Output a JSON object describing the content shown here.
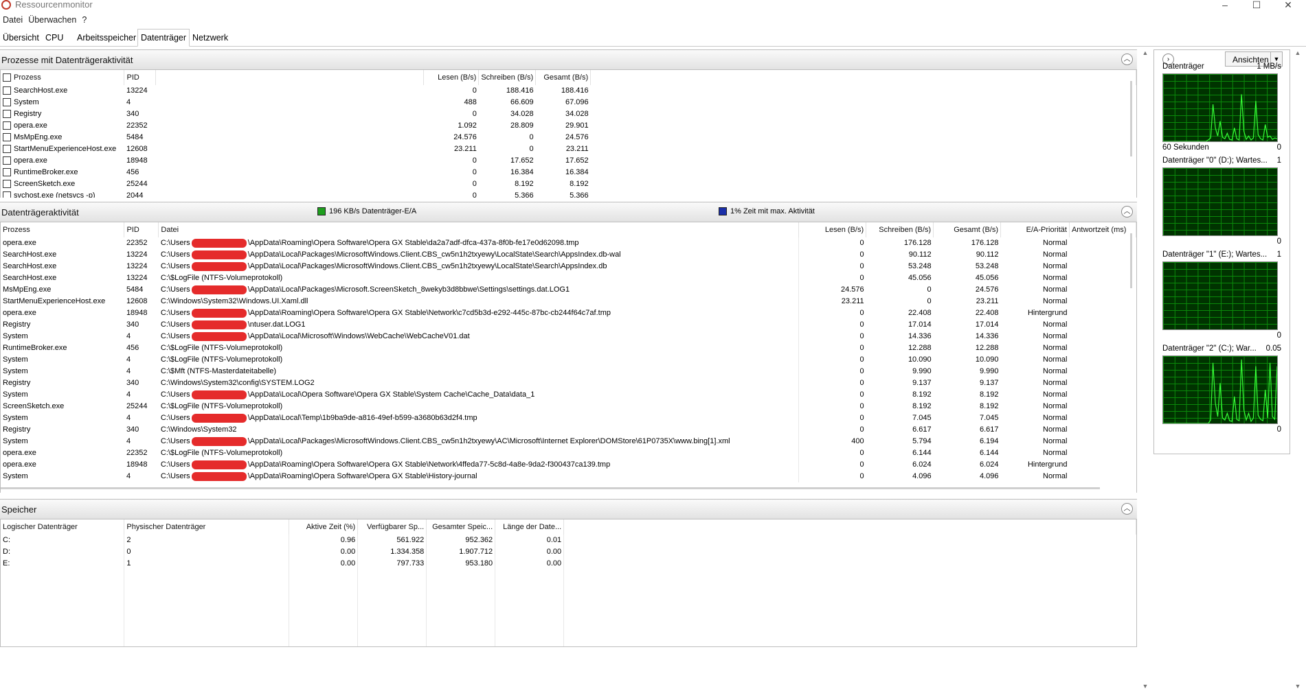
{
  "window": {
    "title": "Ressourcenmonitor",
    "minimize": "–",
    "maximize": "☐",
    "close": "✕"
  },
  "menu": [
    "Datei",
    "Überwachen",
    "?"
  ],
  "tabs": [
    "Übersicht",
    "CPU",
    "Arbeitsspeicher",
    "Datenträger",
    "Netzwerk"
  ],
  "active_tab": "Datenträger",
  "processes": {
    "title": "Prozesse mit Datenträgeraktivität",
    "headers": [
      "Prozess",
      "PID",
      "Lesen (B/s)",
      "Schreiben (B/s)",
      "Gesamt (B/s)"
    ],
    "rows": [
      [
        "SearchHost.exe",
        "13224",
        "0",
        "188.416",
        "188.416"
      ],
      [
        "System",
        "4",
        "488",
        "66.609",
        "67.096"
      ],
      [
        "Registry",
        "340",
        "0",
        "34.028",
        "34.028"
      ],
      [
        "opera.exe",
        "22352",
        "1.092",
        "28.809",
        "29.901"
      ],
      [
        "MsMpEng.exe",
        "5484",
        "24.576",
        "0",
        "24.576"
      ],
      [
        "StartMenuExperienceHost.exe",
        "12608",
        "23.211",
        "0",
        "23.211"
      ],
      [
        "opera.exe",
        "18948",
        "0",
        "17.652",
        "17.652"
      ],
      [
        "RuntimeBroker.exe",
        "456",
        "0",
        "16.384",
        "16.384"
      ],
      [
        "ScreenSketch.exe",
        "25244",
        "0",
        "8.192",
        "8.192"
      ],
      [
        "svchost.exe (netsvcs -p)",
        "2044",
        "0",
        "5.366",
        "5.366"
      ]
    ]
  },
  "disk_activity": {
    "title": "Datenträgeraktivität",
    "legend_io": "196 KB/s Datenträger-E/A",
    "legend_time": "1% Zeit mit max. Aktivität",
    "color_io": "#1e9e1e",
    "color_time": "#1b2fa8",
    "headers": [
      "Prozess",
      "PID",
      "Datei",
      "Lesen (B/s)",
      "Schreiben (B/s)",
      "Gesamt (B/s)",
      "E/A-Priorität",
      "Antwortzeit (ms)"
    ],
    "rows": [
      [
        "opera.exe",
        "22352",
        "C:\\Users",
        "\\AppData\\Roaming\\Opera Software\\Opera GX Stable\\da2a7adf-dfca-437a-8f0b-fe17e0d62098.tmp",
        "0",
        "176.128",
        "176.128",
        "Normal"
      ],
      [
        "SearchHost.exe",
        "13224",
        "C:\\Users",
        "\\AppData\\Local\\Packages\\MicrosoftWindows.Client.CBS_cw5n1h2txyewy\\LocalState\\Search\\AppsIndex.db-wal",
        "0",
        "90.112",
        "90.112",
        "Normal"
      ],
      [
        "SearchHost.exe",
        "13224",
        "C:\\Users",
        "\\AppData\\Local\\Packages\\MicrosoftWindows.Client.CBS_cw5n1h2txyewy\\LocalState\\Search\\AppsIndex.db",
        "0",
        "53.248",
        "53.248",
        "Normal"
      ],
      [
        "SearchHost.exe",
        "13224",
        "C:\\$LogFile (NTFS-Volumeprotokoll)",
        "",
        "0",
        "45.056",
        "45.056",
        "Normal"
      ],
      [
        "MsMpEng.exe",
        "5484",
        "C:\\Users",
        "\\AppData\\Local\\Packages\\Microsoft.ScreenSketch_8wekyb3d8bbwe\\Settings\\settings.dat.LOG1",
        "24.576",
        "0",
        "24.576",
        "Normal"
      ],
      [
        "StartMenuExperienceHost.exe",
        "12608",
        "C:\\Windows\\System32\\Windows.UI.Xaml.dll",
        "",
        "23.211",
        "0",
        "23.211",
        "Normal"
      ],
      [
        "opera.exe",
        "18948",
        "C:\\Users",
        "\\AppData\\Roaming\\Opera Software\\Opera GX Stable\\Network\\c7cd5b3d-e292-445c-87bc-cb244f64c7af.tmp",
        "0",
        "22.408",
        "22.408",
        "Hintergrund"
      ],
      [
        "Registry",
        "340",
        "C:\\Users",
        "\\ntuser.dat.LOG1",
        "0",
        "17.014",
        "17.014",
        "Normal"
      ],
      [
        "System",
        "4",
        "C:\\Users",
        "\\AppData\\Local\\Microsoft\\Windows\\WebCache\\WebCacheV01.dat",
        "0",
        "14.336",
        "14.336",
        "Normal"
      ],
      [
        "RuntimeBroker.exe",
        "456",
        "C:\\$LogFile (NTFS-Volumeprotokoll)",
        "",
        "0",
        "12.288",
        "12.288",
        "Normal"
      ],
      [
        "System",
        "4",
        "C:\\$LogFile (NTFS-Volumeprotokoll)",
        "",
        "0",
        "10.090",
        "10.090",
        "Normal"
      ],
      [
        "System",
        "4",
        "C:\\$Mft (NTFS-Masterdateitabelle)",
        "",
        "0",
        "9.990",
        "9.990",
        "Normal"
      ],
      [
        "Registry",
        "340",
        "C:\\Windows\\System32\\config\\SYSTEM.LOG2",
        "",
        "0",
        "9.137",
        "9.137",
        "Normal"
      ],
      [
        "System",
        "4",
        "C:\\Users",
        "\\AppData\\Local\\Opera Software\\Opera GX Stable\\System Cache\\Cache_Data\\data_1",
        "0",
        "8.192",
        "8.192",
        "Normal"
      ],
      [
        "ScreenSketch.exe",
        "25244",
        "C:\\$LogFile (NTFS-Volumeprotokoll)",
        "",
        "0",
        "8.192",
        "8.192",
        "Normal"
      ],
      [
        "System",
        "4",
        "C:\\Users",
        "\\AppData\\Local\\Temp\\1b9ba9de-a816-49ef-b599-a3680b63d2f4.tmp",
        "0",
        "7.045",
        "7.045",
        "Normal"
      ],
      [
        "Registry",
        "340",
        "C:\\Windows\\System32",
        "",
        "0",
        "6.617",
        "6.617",
        "Normal"
      ],
      [
        "System",
        "4",
        "C:\\Users",
        "\\AppData\\Local\\Packages\\MicrosoftWindows.Client.CBS_cw5n1h2txyewy\\AC\\Microsoft\\Internet Explorer\\DOMStore\\61P0735X\\www.bing[1].xml",
        "400",
        "5.794",
        "6.194",
        "Normal"
      ],
      [
        "opera.exe",
        "22352",
        "C:\\$LogFile (NTFS-Volumeprotokoll)",
        "",
        "0",
        "6.144",
        "6.144",
        "Normal"
      ],
      [
        "opera.exe",
        "18948",
        "C:\\Users",
        "\\AppData\\Roaming\\Opera Software\\Opera GX Stable\\Network\\4ffeda77-5c8d-4a8e-9da2-f300437ca139.tmp",
        "0",
        "6.024",
        "6.024",
        "Hintergrund"
      ],
      [
        "System",
        "4",
        "C:\\Users",
        "\\AppData\\Roaming\\Opera Software\\Opera GX Stable\\History-journal",
        "0",
        "4.096",
        "4.096",
        "Normal"
      ]
    ]
  },
  "storage": {
    "title": "Speicher",
    "headers": [
      "Logischer Datenträger",
      "Physischer Datenträger",
      "Aktive Zeit (%)",
      "Verfügbarer Sp...",
      "Gesamter Speic...",
      "Länge der Date..."
    ],
    "rows": [
      [
        "C:",
        "2",
        "0.96",
        "561.922",
        "952.362",
        "0.01"
      ],
      [
        "D:",
        "0",
        "0.00",
        "1.334.358",
        "1.907.712",
        "0.00"
      ],
      [
        "E:",
        "1",
        "0.00",
        "797.733",
        "953.180",
        "0.00"
      ]
    ]
  },
  "right_panel": {
    "nav_icon": "›",
    "views_button": "Ansichten",
    "graphs": [
      {
        "label": "Datenträger",
        "scale": "1 MB/s",
        "footer_left": "60 Sekunden",
        "footer_right": "0",
        "data": [
          0,
          0,
          0,
          0,
          0,
          0,
          0,
          0,
          0,
          0,
          0,
          0,
          0,
          0,
          0,
          0,
          0,
          0,
          0,
          2,
          5,
          55,
          20,
          8,
          30,
          6,
          4,
          12,
          3,
          2,
          20,
          4,
          2,
          70,
          15,
          3,
          8,
          2,
          5,
          60,
          10,
          4,
          2,
          25,
          6,
          8,
          3,
          5,
          4
        ]
      },
      {
        "label": "Datenträger \"0\" (D:); Wartes...",
        "scale": "1",
        "footer_left": "",
        "footer_right": "0",
        "data": []
      },
      {
        "label": "Datenträger \"1\" (E:); Wartes...",
        "scale": "1",
        "footer_left": "",
        "footer_right": "0",
        "data": []
      },
      {
        "label": "Datenträger \"2\" (C:); War...",
        "scale": "0.05",
        "footer_left": "",
        "footer_right": "0",
        "data": [
          0,
          0,
          0,
          0,
          0,
          0,
          0,
          0,
          0,
          0,
          0,
          0,
          0,
          0,
          0,
          0,
          0,
          0,
          0,
          0,
          5,
          90,
          30,
          10,
          60,
          8,
          5,
          15,
          4,
          3,
          40,
          6,
          4,
          95,
          20,
          5,
          15,
          3,
          8,
          85,
          12,
          6,
          4,
          50,
          8,
          90,
          10,
          6,
          85
        ]
      }
    ]
  }
}
